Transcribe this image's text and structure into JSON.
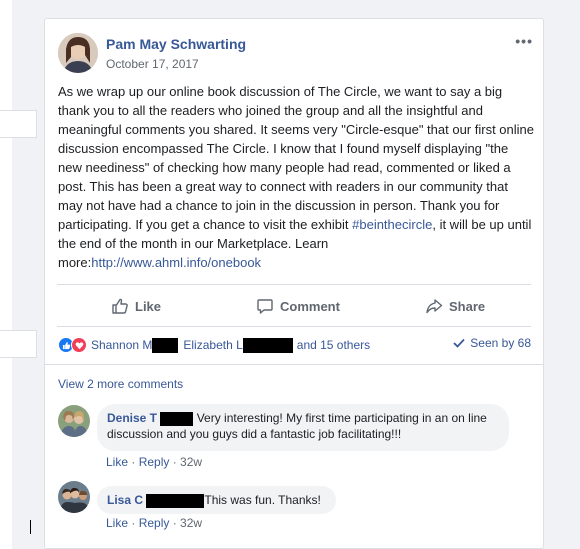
{
  "post": {
    "author": "Pam May Schwarting",
    "date": "October 17, 2017",
    "more_label": "•••",
    "text_main": "As we wrap up our online book discussion of The Circle, we want to say a big thank you to all the readers who joined the group and all the insightful and meaningful comments you shared. It seems very \"Circle-esque\" that our first online discussion encompassed The Circle. I know that I found myself displaying \"the new neediness\" of checking how many people had read, commented or liked a post. This has been a great way to connect with readers in our community that may not have had a chance to join in the discussion in person. Thank you for participating. If you get a chance to visit the exhibit ",
    "hashtag": "#beinthecircle",
    "text_after_hashtag": ", it will be up until the end of the month in our Marketplace. Learn more:",
    "link": "http://www.ahml.info/onebook"
  },
  "actions": {
    "like": "Like",
    "comment": "Comment",
    "share": "Share"
  },
  "reactions": {
    "name1": "Shannon M",
    "name2": "Elizabeth L",
    "others": "and 15 others",
    "seen": "Seen by 68"
  },
  "comments": {
    "view_more": "View 2 more comments",
    "items": [
      {
        "name": "Denise T",
        "text": "Very interesting! My first time participating in an on line discussion and you guys did a fantastic job facilitating!!!",
        "like": "Like",
        "reply": "Reply",
        "time": "32w"
      },
      {
        "name": "Lisa C",
        "text": "This was fun. Thanks!",
        "like": "Like",
        "reply": "Reply",
        "time": "32w"
      }
    ]
  },
  "colors": {
    "link": "#385898",
    "like_blue": "#1877f2",
    "love_red": "#f33e58"
  },
  "icons": [
    "thumbs-up-icon",
    "speech-bubble-icon",
    "share-arrow-icon",
    "like-reaction-icon",
    "love-reaction-icon",
    "checkmark-icon"
  ]
}
